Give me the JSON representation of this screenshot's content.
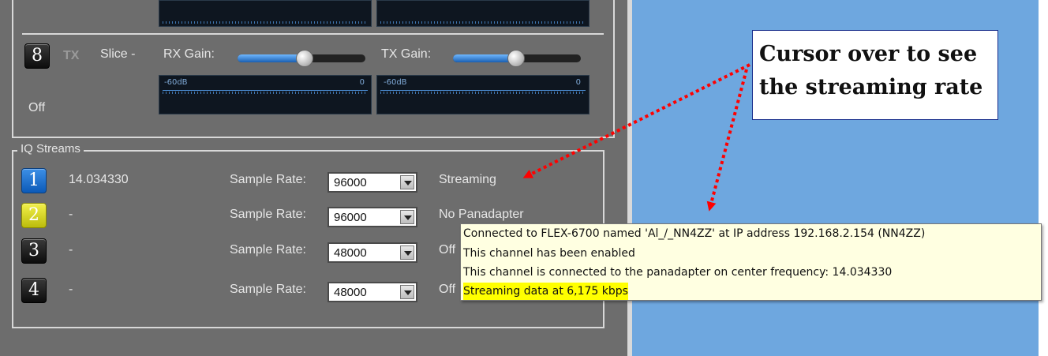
{
  "slice8": {
    "number": "8",
    "tx_label": "TX",
    "slice_label": "Slice -",
    "rx_gain_label": "RX Gain:",
    "tx_gain_label": "TX Gain:",
    "rx_gain_level": 0.52,
    "tx_gain_level": 0.49,
    "state": "Off",
    "meter_min": "-60dB",
    "meter_max": "0"
  },
  "iq_streams": {
    "title": "IQ Streams",
    "rows": [
      {
        "num": "1",
        "color": "#1a6fd0",
        "freq": "14.034330",
        "rate_label": "Sample Rate:",
        "rate": "96000",
        "status": "Streaming"
      },
      {
        "num": "2",
        "color": "#d8d61e",
        "freq": "-",
        "rate_label": "Sample Rate:",
        "rate": "96000",
        "status": "No Panadapter"
      },
      {
        "num": "3",
        "color": "#1a1a1a",
        "freq": "-",
        "rate_label": "Sample Rate:",
        "rate": "48000",
        "status": "Off"
      },
      {
        "num": "4",
        "color": "#1a1a1a",
        "freq": "-",
        "rate_label": "Sample Rate:",
        "rate": "48000",
        "status": "Off"
      }
    ]
  },
  "annotation": {
    "line1": "Cursor over to see",
    "line2": "the streaming rate"
  },
  "tooltip": {
    "line1": "Connected to FLEX-6700 named 'Al_/_NN4ZZ' at IP address 192.168.2.154 (NN4ZZ)",
    "line2": "This channel has been enabled",
    "line3": "This channel is connected to the panadapter on center frequency: 14.034330",
    "line4": "Streaming data at 6,175 kbps"
  },
  "colors": {
    "panel": "#6d6d6d",
    "blue_area": "#6ea7df",
    "arrow": "#ff0000",
    "tooltip_bg": "#ffffe1",
    "highlight": "#ffff00"
  }
}
